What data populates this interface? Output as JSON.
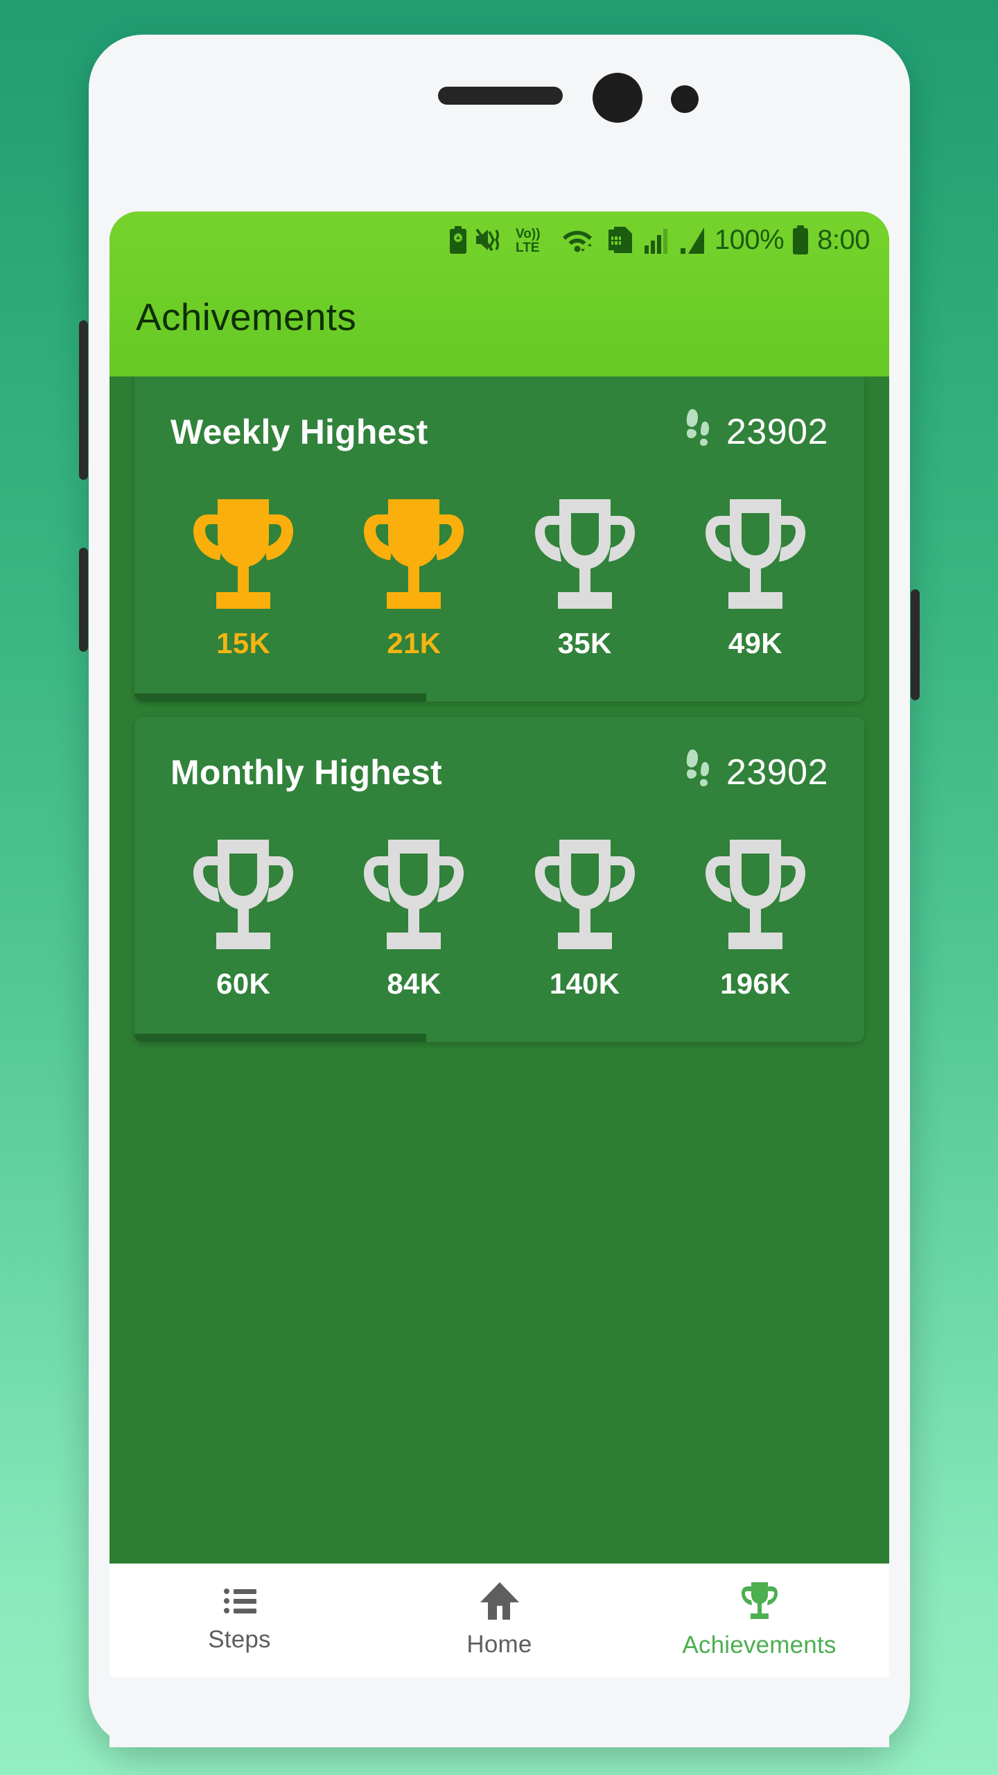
{
  "status_bar": {
    "battery_saver_icon": "battery-saver-icon",
    "mute_icon": "volume-mute-vibrate-icon",
    "volte_label": "Vo)) LTE",
    "wifi_icon": "wifi-icon",
    "sim_icon": "sim-card-icon",
    "signal_1_icon": "signal-bars-icon",
    "signal_2_icon": "signal-triangle-icon",
    "battery_percent": "100%",
    "battery_icon": "battery-full-icon",
    "time": "8:00"
  },
  "header": {
    "title": "Achivements"
  },
  "colors": {
    "app_bar_green": "#6ece28",
    "card_green": "#31823a",
    "screen_green": "#2d7d32",
    "gold": "#FAAF0C",
    "gold_text": "#f5b512",
    "locked_gray": "#DCDCDC",
    "accent_nav": "#4caf50",
    "scroll_thumb": "#1f5e24"
  },
  "cards": [
    {
      "id": "weekly-highest-card",
      "title": "Weekly Highest",
      "steps_icon": "footprints-icon",
      "steps_count": "23902",
      "scroll_fraction": 40,
      "trophies": [
        {
          "label": "15K",
          "state": "earned"
        },
        {
          "label": "21K",
          "state": "earned"
        },
        {
          "label": "35K",
          "state": "locked"
        },
        {
          "label": "49K",
          "state": "locked"
        }
      ]
    },
    {
      "id": "monthly-highest-card",
      "title": "Monthly Highest",
      "steps_icon": "footprints-icon",
      "steps_count": "23902",
      "scroll_fraction": 40,
      "trophies": [
        {
          "label": "60K",
          "state": "locked"
        },
        {
          "label": "84K",
          "state": "locked"
        },
        {
          "label": "140K",
          "state": "locked"
        },
        {
          "label": "196K",
          "state": "locked"
        }
      ]
    }
  ],
  "bottom_nav": {
    "items": [
      {
        "label": "Steps",
        "icon": "list-icon",
        "active": false
      },
      {
        "label": "Home",
        "icon": "home-icon",
        "active": false
      },
      {
        "label": "Achievements",
        "icon": "trophy-icon",
        "active": true
      }
    ]
  }
}
